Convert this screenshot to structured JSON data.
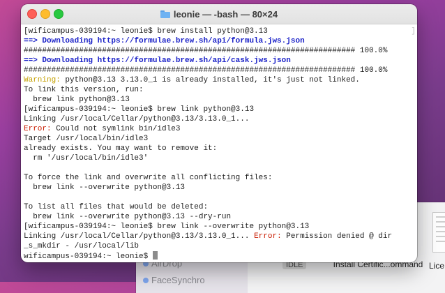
{
  "window": {
    "title": "leonie — -bash — 80×24"
  },
  "terminal_lines": [
    [
      {
        "t": "[wificampus-039194:~ leonie$ brew install python@3.13",
        "c": ""
      }
    ],
    [
      {
        "t": "==> Downloading https://formulae.brew.sh/api/formula.jws.json",
        "c": "blue"
      }
    ],
    [
      {
        "t": "######################################################################## 100.0%",
        "c": ""
      }
    ],
    [
      {
        "t": "==> Downloading https://formulae.brew.sh/api/cask.jws.json",
        "c": "blue"
      }
    ],
    [
      {
        "t": "######################################################################## 100.0%",
        "c": ""
      }
    ],
    [
      {
        "t": "Warning:",
        "c": "warn"
      },
      {
        "t": " python@3.13 3.13.0_1 is already installed, it's just not linked.",
        "c": ""
      }
    ],
    [
      {
        "t": "To link this version, run:",
        "c": ""
      }
    ],
    [
      {
        "t": "  brew link python@3.13",
        "c": ""
      }
    ],
    [
      {
        "t": "[wificampus-039194:~ leonie$ brew link python@3.13",
        "c": ""
      }
    ],
    [
      {
        "t": "Linking /usr/local/Cellar/python@3.13/3.13.0_1...",
        "c": ""
      }
    ],
    [
      {
        "t": "Error:",
        "c": "err"
      },
      {
        "t": " Could not symlink bin/idle3",
        "c": ""
      }
    ],
    [
      {
        "t": "Target /usr/local/bin/idle3",
        "c": ""
      }
    ],
    [
      {
        "t": "already exists. You may want to remove it:",
        "c": ""
      }
    ],
    [
      {
        "t": "  rm '/usr/local/bin/idle3'",
        "c": ""
      }
    ],
    [
      {
        "t": "",
        "c": ""
      }
    ],
    [
      {
        "t": "To force the link and overwrite all conflicting files:",
        "c": ""
      }
    ],
    [
      {
        "t": "  brew link --overwrite python@3.13",
        "c": ""
      }
    ],
    [
      {
        "t": "",
        "c": ""
      }
    ],
    [
      {
        "t": "To list all files that would be deleted:",
        "c": ""
      }
    ],
    [
      {
        "t": "  brew link --overwrite python@3.13 --dry-run",
        "c": ""
      }
    ],
    [
      {
        "t": "[wificampus-039194:~ leonie$ brew link --overwrite python@3.13",
        "c": ""
      }
    ],
    [
      {
        "t": "Linking /usr/local/Cellar/python@3.13/3.13.0_1... ",
        "c": ""
      },
      {
        "t": "Error:",
        "c": "err"
      },
      {
        "t": " Permission denied @ dir",
        "c": ""
      }
    ],
    [
      {
        "t": "_s_mkdir - /usr/local/lib",
        "c": ""
      }
    ],
    [
      {
        "t": "wificampus-039194:~ leonie$ ",
        "c": ""
      }
    ]
  ],
  "background_finder": {
    "sidebar_items": [
      "AirDrop",
      "FaceSynchro"
    ],
    "files": [
      "Install Certific...ommand",
      "Lice"
    ],
    "badge": "IDLE"
  },
  "colors": {
    "prompt_blue": "#1b22c8",
    "warning": "#c4a000",
    "error": "#c91b00"
  }
}
